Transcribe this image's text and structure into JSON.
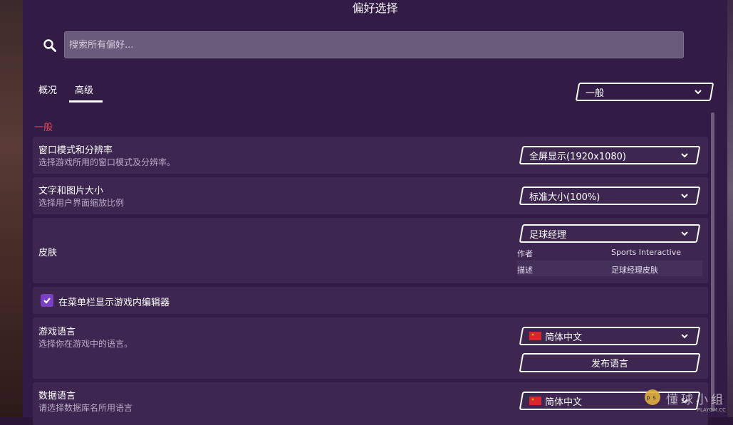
{
  "window": {
    "title": "偏好选择"
  },
  "search": {
    "placeholder": "搜索所有偏好...",
    "value": ""
  },
  "tabs": [
    {
      "label": "概况",
      "active": false
    },
    {
      "label": "高级",
      "active": true
    }
  ],
  "category_select": {
    "value": "一般"
  },
  "section": {
    "heading": "一般"
  },
  "settings": {
    "window_mode": {
      "title": "窗口模式和分辨率",
      "description": "选择游戏所用的窗口模式及分辨率。",
      "value": "全屏显示(1920x1080)"
    },
    "text_size": {
      "title": "文字和图片大小",
      "description": "选择用户界面缩放比例",
      "value": "标准大小(100%)"
    },
    "skin": {
      "title": "皮肤",
      "value": "足球经理",
      "author_label": "作者",
      "author_value": "Sports Interactive",
      "desc_label": "描述",
      "desc_value": "足球经理皮肤"
    },
    "editor_in_menu": {
      "label": "在菜单栏显示游戏内编辑器",
      "checked": true
    },
    "game_language": {
      "title": "游戏语言",
      "description": "选择你在游戏中的语言。",
      "value": "简体中文",
      "publish_button": "发布语言"
    },
    "data_language": {
      "title": "数据语言",
      "description": "请选择数据库名所用语言",
      "value": "简体中文"
    }
  },
  "watermark": {
    "text": "懂球小组",
    "url": "PLAYGM.CC",
    "logo": "ps"
  },
  "colors": {
    "accent": "#e8455a",
    "background": "#321b45",
    "checkbox": "#7a3fc4"
  },
  "icons": [
    "search-icon",
    "chevron-down-icon",
    "checkmark-icon",
    "china-flag-icon"
  ]
}
